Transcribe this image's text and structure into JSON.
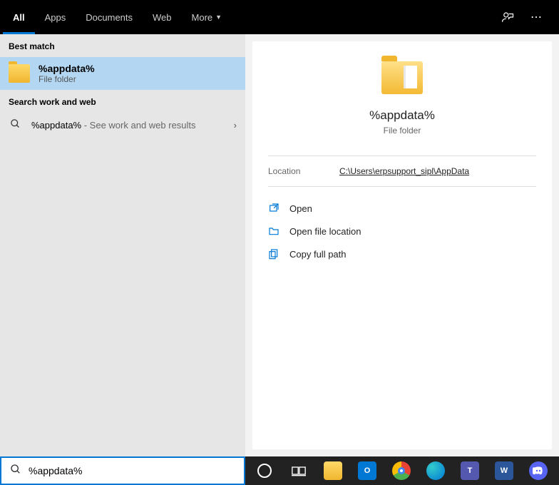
{
  "topbar": {
    "tabs": [
      "All",
      "Apps",
      "Documents",
      "Web",
      "More"
    ]
  },
  "results": {
    "bestMatchHeader": "Best match",
    "bestMatch": {
      "title": "%appdata%",
      "sub": "File folder"
    },
    "webHeader": "Search work and web",
    "webRow": {
      "query": "%appdata%",
      "suffix": " - See work and web results"
    }
  },
  "details": {
    "title": "%appdata%",
    "sub": "File folder",
    "locationLabel": "Location",
    "locationValue": "C:\\Users\\erpsupport_sipl\\AppData",
    "actions": {
      "open": "Open",
      "openLoc": "Open file location",
      "copy": "Copy full path"
    }
  },
  "search": {
    "value": "%appdata%"
  }
}
